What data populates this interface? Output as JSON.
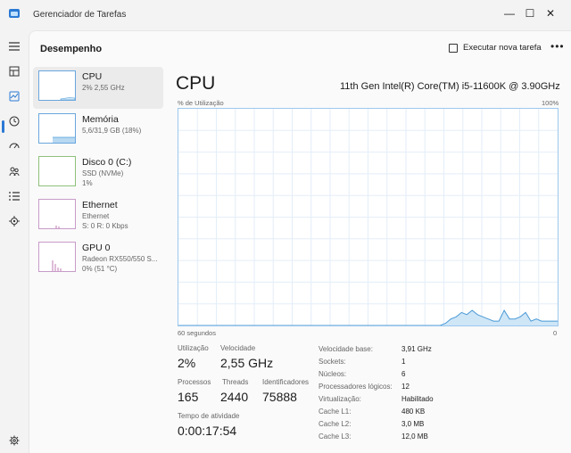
{
  "window": {
    "title": "Gerenciador de Tarefas",
    "minimize": "—",
    "maximize": "☐",
    "close": "✕"
  },
  "header": {
    "page_title": "Desempenho",
    "run_task_label": "Executar nova tarefa",
    "more_label": "•••"
  },
  "devices": [
    {
      "name": "CPU",
      "sub": "2% 2,55 GHz",
      "sub2": ""
    },
    {
      "name": "Memória",
      "sub": "5,6/31,9 GB (18%)",
      "sub2": ""
    },
    {
      "name": "Disco 0 (C:)",
      "sub": "SSD (NVMe)",
      "sub2": "1%"
    },
    {
      "name": "Ethernet",
      "sub": "Ethernet",
      "sub2": "S: 0 R: 0 Kbps"
    },
    {
      "name": "GPU 0",
      "sub": "Radeon RX550/550 S...",
      "sub2": "0% (51 °C)"
    }
  ],
  "main": {
    "title": "CPU",
    "model": "11th Gen Intel(R) Core(TM) i5-11600K @ 3.90GHz",
    "chart_top_left": "% de Utilização",
    "chart_top_right": "100%",
    "chart_bottom_left": "60 segundos",
    "chart_bottom_right": "0"
  },
  "chart_data": {
    "type": "area",
    "ylim": [
      0,
      100
    ],
    "values": [
      0,
      0,
      0,
      0,
      0,
      0,
      0,
      0,
      0,
      0,
      0,
      0,
      0,
      0,
      0,
      0,
      0,
      0,
      0,
      0,
      0,
      0,
      0,
      0,
      0,
      0,
      0,
      0,
      0,
      0,
      0,
      0,
      0,
      0,
      0,
      0,
      0,
      0,
      0,
      0,
      0,
      0,
      0,
      0,
      0,
      0,
      0,
      0,
      0,
      0,
      1,
      3,
      4,
      6,
      5,
      7,
      5,
      4,
      3,
      2,
      2,
      7,
      3,
      3,
      4,
      6,
      2,
      3,
      2,
      2,
      2,
      2
    ]
  },
  "stats": {
    "utilization_label": "Utilização",
    "utilization_value": "2%",
    "speed_label": "Velocidade",
    "speed_value": "2,55 GHz",
    "processes_label": "Processos",
    "processes_value": "165",
    "threads_label": "Threads",
    "threads_value": "2440",
    "handles_label": "Identificadores",
    "handles_value": "75888",
    "uptime_label": "Tempo de atividade",
    "uptime_value": "0:00:17:54"
  },
  "details": [
    {
      "label": "Velocidade base:",
      "value": "3,91 GHz"
    },
    {
      "label": "Sockets:",
      "value": "1"
    },
    {
      "label": "Núcleos:",
      "value": "6"
    },
    {
      "label": "Processadores lógicos:",
      "value": "12"
    },
    {
      "label": "Virtualização:",
      "value": "Habilitado"
    },
    {
      "label": "Cache L1:",
      "value": "480 KB"
    },
    {
      "label": "Cache L2:",
      "value": "3,0 MB"
    },
    {
      "label": "Cache L3:",
      "value": "12,0 MB"
    }
  ],
  "colors": {
    "accent": "#2b79d4",
    "chart_line": "#4a9ad6",
    "chart_fill": "#cfe6f7",
    "grid": "#e3eef8"
  }
}
